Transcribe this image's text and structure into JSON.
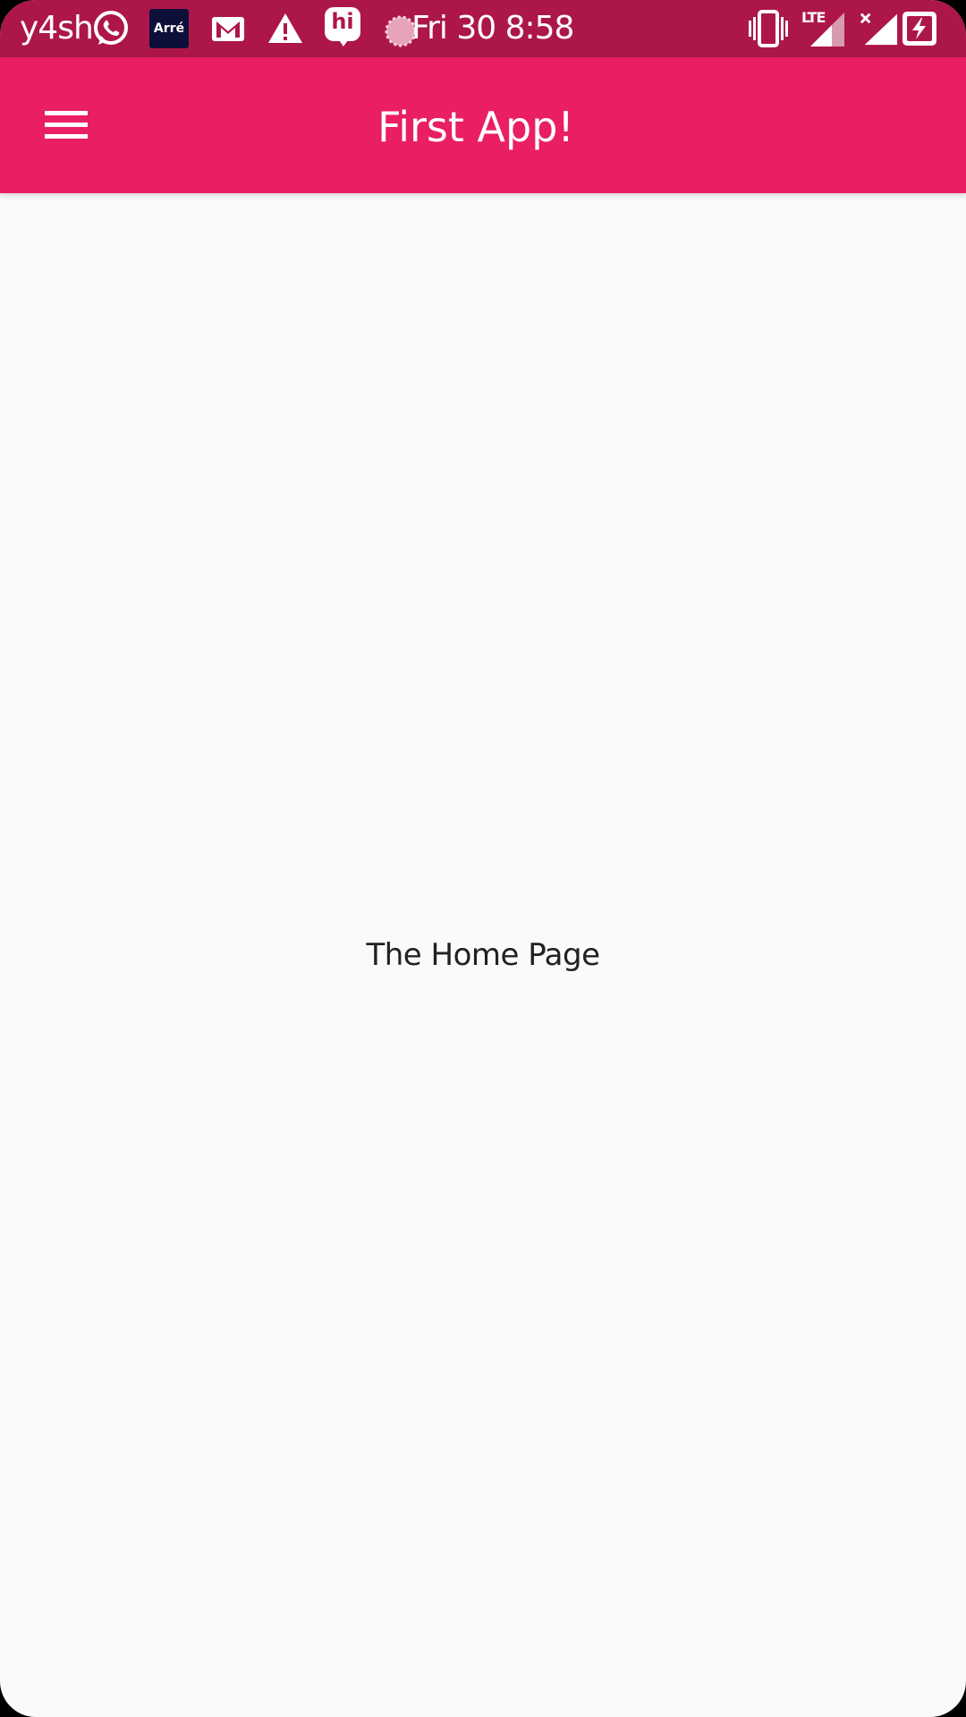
{
  "status_bar": {
    "carrier": "y4sh",
    "clock": "Fri 30 8:58",
    "notification_icons": [
      "whatsapp-icon",
      "arre-app-icon",
      "gmail-icon",
      "warning-icon",
      "hike-icon",
      "loading-spinner-icon"
    ],
    "arre_label": "Arré",
    "hike_label": "hi",
    "lte_label": "LTE",
    "system_icons": [
      "vibrate-icon",
      "lte-signal-icon",
      "no-signal-icon",
      "battery-charging-icon"
    ],
    "background_color": "#ad1648"
  },
  "app_bar": {
    "title": "First App!",
    "menu_icon": "hamburger-menu-icon",
    "background_color": "#e91e63"
  },
  "main": {
    "body_text": "The Home Page",
    "background_color": "#fafafa"
  }
}
